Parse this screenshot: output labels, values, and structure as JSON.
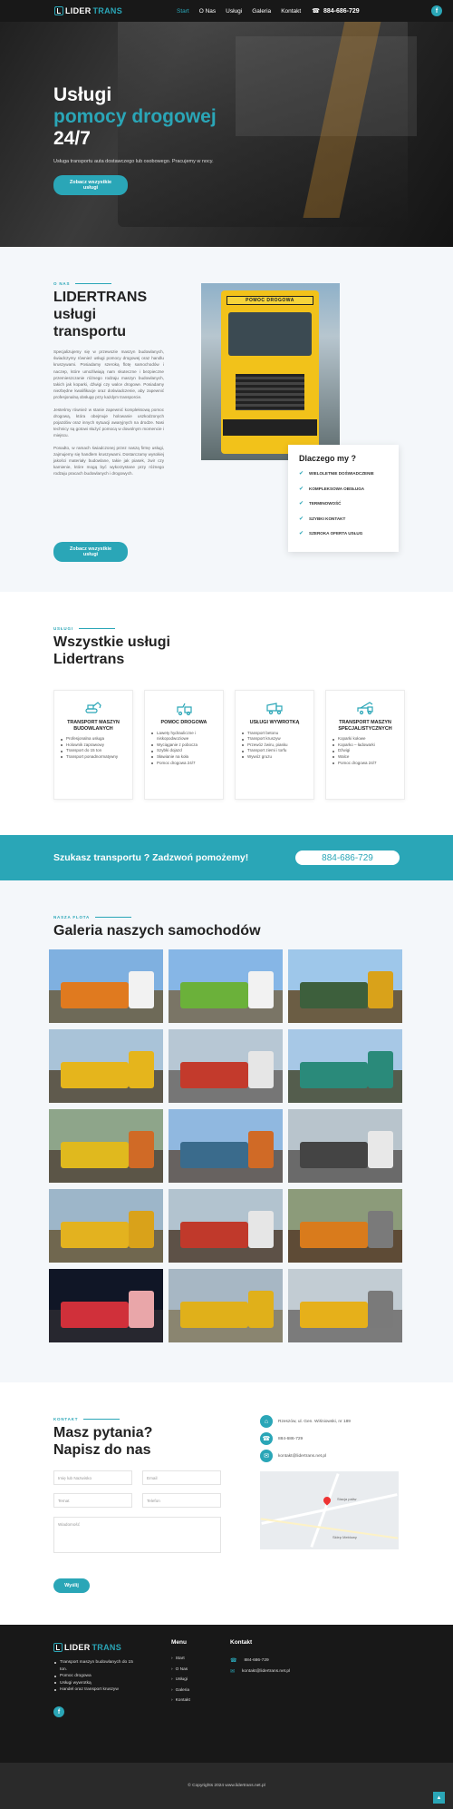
{
  "brand": {
    "name_part1": "LIDER",
    "name_part2": "TRANS",
    "accent_color": "#2aa6b7"
  },
  "nav": {
    "items": [
      {
        "label": "Start",
        "active": true
      },
      {
        "label": "O Nas"
      },
      {
        "label": "Usługi"
      },
      {
        "label": "Galeria"
      },
      {
        "label": "Kontakt"
      }
    ],
    "phone": "884-686-729",
    "facebook": "f"
  },
  "hero": {
    "title_line1": "Usługi",
    "title_line2": "pomocy drogowej",
    "title_line3": "24/7",
    "subtitle": "Usługa transportu auta dostawczego lub osobowego. Pracujemy w nocy.",
    "button": "Zobacz wszystkie usługi"
  },
  "about": {
    "eyebrow": "O NAS",
    "title": "LIDERTRANS usługi transportu",
    "paragraphs": [
      "Specjalizujemy się w przewozie maszyn budowlanych, świadczymy również usługi pomocy drogowej oraz handlu kruszywami. Posiadamy szeroką flotę samochodów i naczep, które umożliwiają nam skuteczne i bezpieczne przemieszczanie różnego rodzaju maszyn budowlanych, takich jak koparki, dźwigi czy walce drogowe. Posiadamy niezbędne kwalifikacje oraz doświadczenie, aby zapewnić profesjonalną obsługę przy każdym transporcie.",
      "Jesteśmy również w stanie zapewnić kompleksową pomoc drogową, która obejmuje holowanie uszkodzonych pojazdów oraz innych sytuacji awaryjnych na drodze. Nasi technicy są gotowi służyć pomocą w dowolnym momencie i miejscu.",
      "Ponadto, w ramach świadczonej przez naszą firmę usługi, zajmujemy się handlem kruszywami. Dostarczamy wysokiej jakości materiały budowlane, takie jak piasek, żwir czy kamienie, które mogą być wykorzystane przy różnego rodzaju pracach budowlanych i drogowych."
    ],
    "button": "Zobacz wszystkie usługi",
    "photo_sign": "POMOC DROGOWA",
    "why_title": "Dlaczego my ?",
    "why_items": [
      "WIELOLETNIE DOŚWIADCZENIE",
      "KOMPLEKSOWA OBSŁUGA",
      "TERMINOWOŚĆ",
      "SZYBKI KONTAKT",
      "SZEROKA OFERTA USŁUG"
    ]
  },
  "services": {
    "eyebrow": "USŁUGI",
    "title_line1": "Wszystkie usługi",
    "title_line2": "Lidertrans",
    "cards": [
      {
        "icon": "excavator-icon",
        "title": "TRANSPORT MASZYN BUDOWLANYCH",
        "items": [
          "Profesjonalna usługa",
          "Holownik zaprawowy",
          "Transport do 15 ton",
          "Transport ponadnormatywny"
        ]
      },
      {
        "icon": "tow-truck-icon",
        "title": "POMOC DROGOWA",
        "items": [
          "Lawety hydrauliczne i niskopodwoziowe",
          "Wyciąganie z pobocza",
          "Szybki dojazd",
          "Sławianie na koła",
          "Pomoc drogowa 24/7"
        ]
      },
      {
        "icon": "dump-truck-icon",
        "title": "USŁUGI WYWROTKĄ",
        "items": [
          "Transport betonu",
          "Transport kruszyw",
          "Przewóz żwiru, piasku",
          "Transport ziemi i torfu",
          "Wywóz gruzu"
        ]
      },
      {
        "icon": "crane-truck-icon",
        "title": "TRANSPORT MASZYN SPECJALISTYCZNYCH",
        "items": [
          "Koparki kołowe",
          "Koparko – ładowarki",
          "Dźwigi",
          "Walce",
          "Pomoc drogowa 24/7"
        ]
      }
    ]
  },
  "cta": {
    "text": "Szukasz transportu ? Zadzwoń pomożemy!",
    "phone": "884-686-729"
  },
  "gallery": {
    "eyebrow": "NASZA FLOTA",
    "title": "Galeria naszych samochodów",
    "photos": [
      {
        "sky": "#7fb0e0",
        "ground": "#6e6a58",
        "veh": "#e07a1f",
        "cab": "#f2f2f2"
      },
      {
        "sky": "#86b6e6",
        "ground": "#7a7566",
        "veh": "#6bb13a",
        "cab": "#f2f2f2"
      },
      {
        "sky": "#9ec7ea",
        "ground": "#6b5d44",
        "veh": "#3d5f3c",
        "cab": "#d9a21a"
      },
      {
        "sky": "#a9c3d8",
        "ground": "#5f5a4d",
        "veh": "#e5b51c",
        "cab": "#e5b51c"
      },
      {
        "sky": "#b7c7d4",
        "ground": "#767676",
        "veh": "#c33a2c",
        "cab": "#e6e6e6"
      },
      {
        "sky": "#a7c8e6",
        "ground": "#545d4d",
        "veh": "#2a8a7a",
        "cab": "#2a8a7a"
      },
      {
        "sky": "#8ea58a",
        "ground": "#5b5547",
        "veh": "#e0b91e",
        "cab": "#d06a26"
      },
      {
        "sky": "#90b8e0",
        "ground": "#676260",
        "veh": "#3a6b8c",
        "cab": "#d06a26"
      },
      {
        "sky": "#b8c4cc",
        "ground": "#6a6a6a",
        "veh": "#444444",
        "cab": "#e8e8e8"
      },
      {
        "sky": "#9db6c9",
        "ground": "#70674f",
        "veh": "#e3b21f",
        "cab": "#d9a21a"
      },
      {
        "sky": "#b2c3cf",
        "ground": "#5d5147",
        "veh": "#c0392b",
        "cab": "#e6e6e6"
      },
      {
        "sky": "#8c9b7a",
        "ground": "#5e4b36",
        "veh": "#d97b1c",
        "cab": "#7a7a7a"
      },
      {
        "sky": "#101626",
        "ground": "#27272f",
        "veh": "#d0303a",
        "cab": "#e9a6a9"
      },
      {
        "sky": "#a7b7c4",
        "ground": "#8a8570",
        "veh": "#e0b01a",
        "cab": "#e0b01a"
      },
      {
        "sky": "#c2ccd3",
        "ground": "#7b7b7b",
        "veh": "#e6b01a",
        "cab": "#7a7a7a"
      }
    ]
  },
  "contact": {
    "eyebrow": "KONTAKT",
    "title_line1": "Masz pytania?",
    "title_line2": "Napisz do nas",
    "placeholders": {
      "name": "Imię lub Nazwisko",
      "email": "Email",
      "subject": "Temat",
      "phone": "Telefon",
      "message": "Wiadomość"
    },
    "button": "Wyślij",
    "address": "Rzeszów, ul. Gen. Wiśniowski, nr 189",
    "phone": "884-686-729",
    "email": "kontakt@lidertrans.net.pl",
    "map_labels": [
      "Stacja paliw",
      "Sklep Meblowy"
    ]
  },
  "footer": {
    "list": [
      "Transport maszyn budowlanych do 15 ton.",
      "Pomoc drogowa",
      "Usługi wywrotką",
      "Handel oraz transport kruszyw"
    ],
    "menu_title": "Menu",
    "menu": [
      "Start",
      "O Nas",
      "Usługi",
      "Galeria",
      "Kontakt"
    ],
    "contact_title": "Kontakt",
    "phone": "884-686-729",
    "email": "kontakt@lidertrans.net.pl",
    "copyright": "© Copyrights 2024 www.lidertrans.net.pl"
  }
}
